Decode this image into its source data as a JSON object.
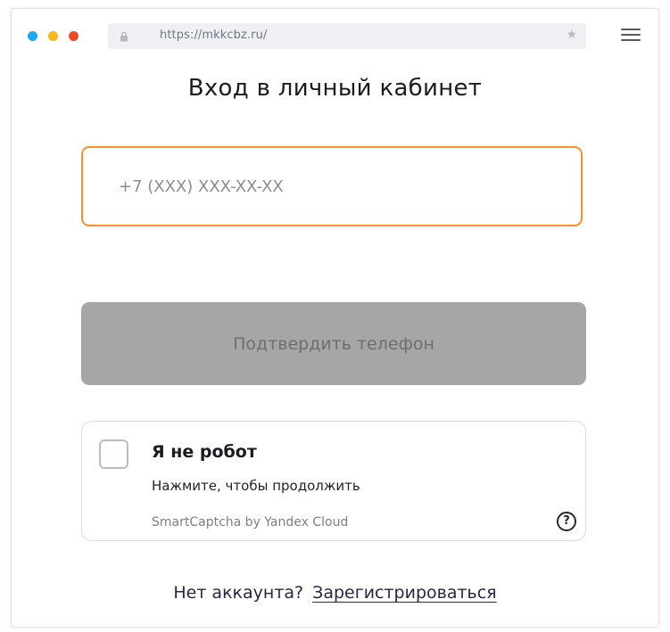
{
  "browser": {
    "url": "https://mkkcbz.ru/",
    "dots": {
      "blue": "#1aa9f0",
      "yellow": "#f5b71c",
      "red": "#ec4a25"
    }
  },
  "page": {
    "title": "Вход в личный кабинет",
    "phone_input": {
      "value": "",
      "placeholder": "+7 (XXX) XXX-XX-XX"
    },
    "confirm_button_label": "Подтвердить телефон",
    "captcha": {
      "title": "Я не робот",
      "hint": "Нажмите, чтобы продолжить",
      "brand": "SmartCaptcha by Yandex Cloud",
      "help_symbol": "?"
    },
    "footer": {
      "question": "Нет аккаунта?",
      "register_link": "Зарегистрироваться"
    }
  },
  "colors": {
    "accent": "#f5922e",
    "button_disabled": "#a6a6a6",
    "link": "#24284a"
  },
  "icons": {
    "lock": "lock-icon",
    "star": "star-icon",
    "menu": "hamburger-menu-icon",
    "help": "help-icon"
  }
}
